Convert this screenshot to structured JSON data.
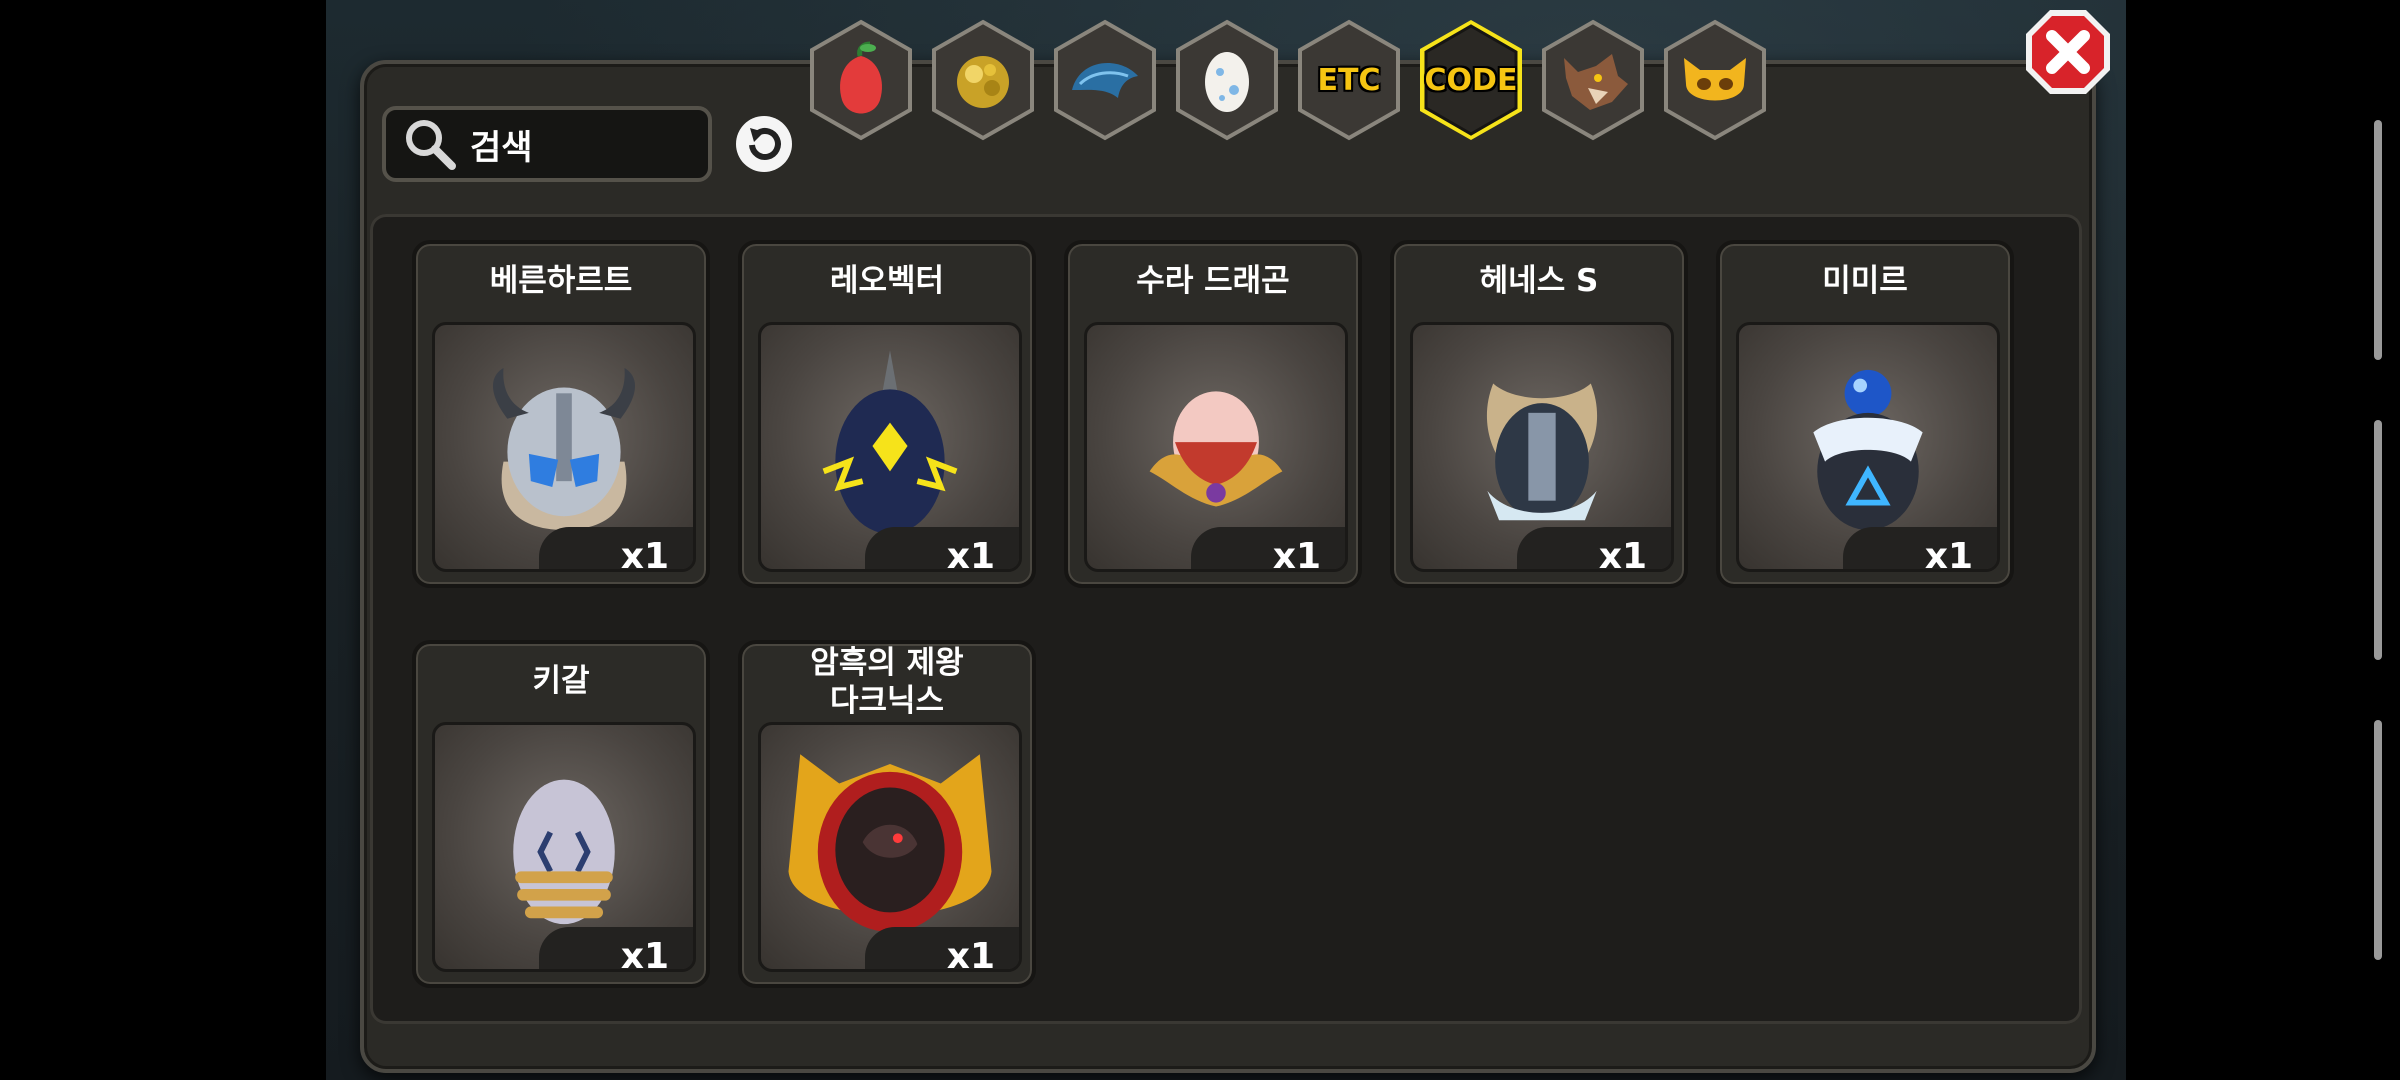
{
  "search": {
    "placeholder_text": "검색"
  },
  "tabs": [
    {
      "icon": "fruit-icon",
      "label": ""
    },
    {
      "icon": "gold-ore-icon",
      "label": ""
    },
    {
      "icon": "dragon-scale-icon",
      "label": ""
    },
    {
      "icon": "egg-icon",
      "label": ""
    },
    {
      "icon": "etc-icon",
      "label": "ETC"
    },
    {
      "icon": "code-icon",
      "label": "CODE",
      "selected": true
    },
    {
      "icon": "wolf-icon",
      "label": ""
    },
    {
      "icon": "demon-icon",
      "label": ""
    }
  ],
  "items": [
    {
      "name": "베른하르트",
      "qty": "x1",
      "icon": "viking-helmet-egg-icon"
    },
    {
      "name": "레오벡터",
      "qty": "x1",
      "icon": "thunder-egg-icon"
    },
    {
      "name": "수라 드래곤",
      "qty": "x1",
      "icon": "pink-dragon-egg-icon"
    },
    {
      "name": "헤네스 S",
      "qty": "x1",
      "icon": "armored-egg-icon"
    },
    {
      "name": "미미르",
      "qty": "x1",
      "icon": "blue-orb-egg-icon"
    },
    {
      "name": "키갈",
      "qty": "x1",
      "icon": "silver-egg-icon"
    },
    {
      "name": "암흑의 제왕\n다크닉스",
      "name_line1": "암흑의 제왕",
      "name_line2": "다크닉스",
      "qty": "x1",
      "icon": "dark-emperor-egg-icon"
    }
  ],
  "colors": {
    "selected_tab_glow": "#f6e31a",
    "close_button": "#d8232a",
    "panel": "#2b2a26"
  }
}
